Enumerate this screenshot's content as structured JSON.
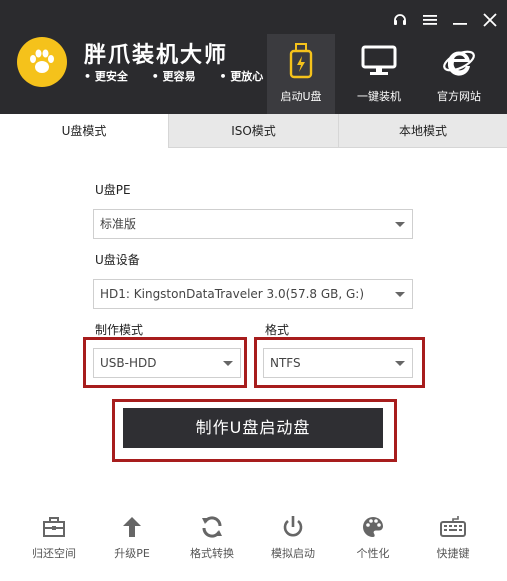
{
  "app": {
    "title": "胖爪装机大师",
    "slogans": [
      "更安全",
      "更容易",
      "更放心"
    ]
  },
  "nav": [
    {
      "label": "启动U盘",
      "icon": "usb-drive-icon",
      "active": true
    },
    {
      "label": "一键装机",
      "icon": "monitor-icon",
      "active": false
    },
    {
      "label": "官方网站",
      "icon": "ie-browser-icon",
      "active": false
    }
  ],
  "window_controls": [
    "headset-icon",
    "menu-icon",
    "minimize-icon",
    "close-icon"
  ],
  "tabs": [
    {
      "label": "U盘模式",
      "active": true
    },
    {
      "label": "ISO模式",
      "active": false
    },
    {
      "label": "本地模式",
      "active": false
    }
  ],
  "form": {
    "pe_label": "U盘PE",
    "pe_value": "标准版",
    "device_label": "U盘设备",
    "device_value": "HD1: KingstonDataTraveler 3.0(57.8 GB, G:)",
    "mode_label": "制作模式",
    "mode_value": "USB-HDD",
    "format_label": "格式",
    "format_value": "NTFS",
    "make_button": "制作U盘启动盘"
  },
  "toolbar": [
    {
      "label": "归还空间",
      "icon": "toolbox-icon"
    },
    {
      "label": "升级PE",
      "icon": "arrow-up-icon"
    },
    {
      "label": "格式转换",
      "icon": "refresh-icon"
    },
    {
      "label": "模拟启动",
      "icon": "power-icon"
    },
    {
      "label": "个性化",
      "icon": "palette-icon"
    },
    {
      "label": "快捷键",
      "icon": "keyboard-icon"
    }
  ],
  "colors": {
    "header_bg": "#2b2b2e",
    "logo_yellow": "#f5c21b",
    "highlight_red": "#a71d1d",
    "button_dark": "#2f2f33"
  }
}
